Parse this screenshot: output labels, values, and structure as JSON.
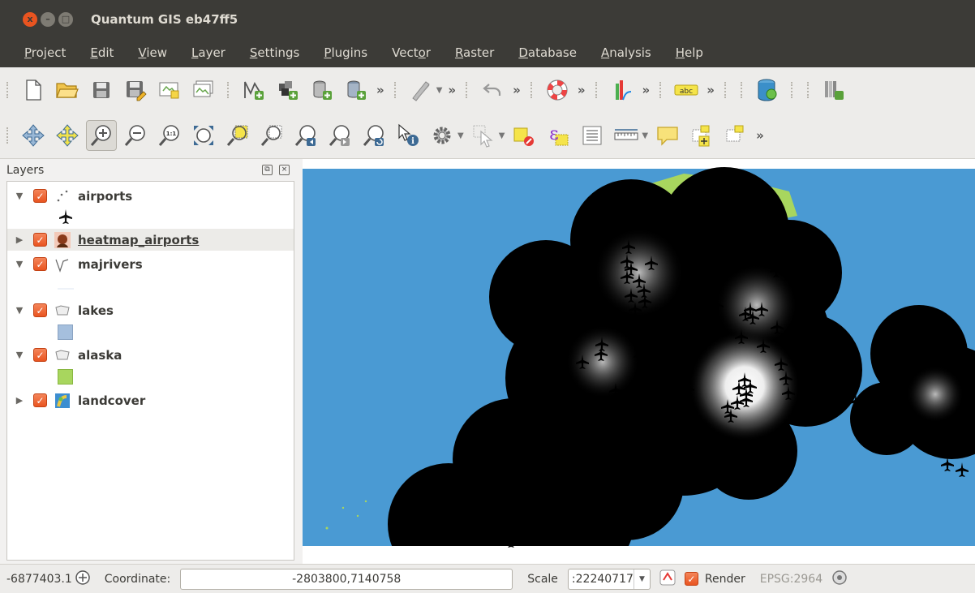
{
  "window": {
    "title": "Quantum GIS eb47ff5",
    "close_glyph": "x",
    "min_glyph": "–",
    "max_glyph": "□"
  },
  "menu": [
    {
      "label": "Project",
      "accel": "P"
    },
    {
      "label": "Edit",
      "accel": "E"
    },
    {
      "label": "View",
      "accel": "V"
    },
    {
      "label": "Layer",
      "accel": "L"
    },
    {
      "label": "Settings",
      "accel": "S"
    },
    {
      "label": "Plugins",
      "accel": "P"
    },
    {
      "label": "Vector",
      "accel": "o"
    },
    {
      "label": "Raster",
      "accel": "R"
    },
    {
      "label": "Database",
      "accel": "D"
    },
    {
      "label": "Analysis",
      "accel": "A"
    },
    {
      "label": "Help",
      "accel": "H"
    }
  ],
  "toolbar_chevron": "»",
  "layers_panel": {
    "title": "Layers",
    "float_glyph": "⧉",
    "close_glyph": "×",
    "layers": [
      {
        "name": "airports",
        "expanded": true,
        "checked": true,
        "icon": "point-layer-icon",
        "symbol": "airplane-symbol-icon"
      },
      {
        "name": "heatmap_airports",
        "expanded": false,
        "checked": true,
        "icon": "raster-heatmap-icon",
        "selected": true
      },
      {
        "name": "majrivers",
        "expanded": true,
        "checked": true,
        "icon": "line-layer-icon",
        "symbol": "line-symbol-icon"
      },
      {
        "name": "lakes",
        "expanded": true,
        "checked": true,
        "icon": "polygon-layer-icon",
        "symbol_color": "#a5bfdd"
      },
      {
        "name": "alaska",
        "expanded": true,
        "checked": true,
        "icon": "polygon-layer-icon",
        "symbol_color": "#a8d65e"
      },
      {
        "name": "landcover",
        "expanded": false,
        "checked": true,
        "icon": "raster-layer-icon"
      }
    ]
  },
  "map": {
    "ocean_color": "#4a9ad3",
    "land_color": "#a8d65e"
  },
  "status": {
    "partial_coord": "-6877403.1",
    "coordinate_label": "Coordinate:",
    "coordinate_value": "-2803800,7140758",
    "scale_label": "Scale",
    "scale_value": ":22240717",
    "render_label": "Render",
    "render_checked": true,
    "crs": "EPSG:2964"
  }
}
